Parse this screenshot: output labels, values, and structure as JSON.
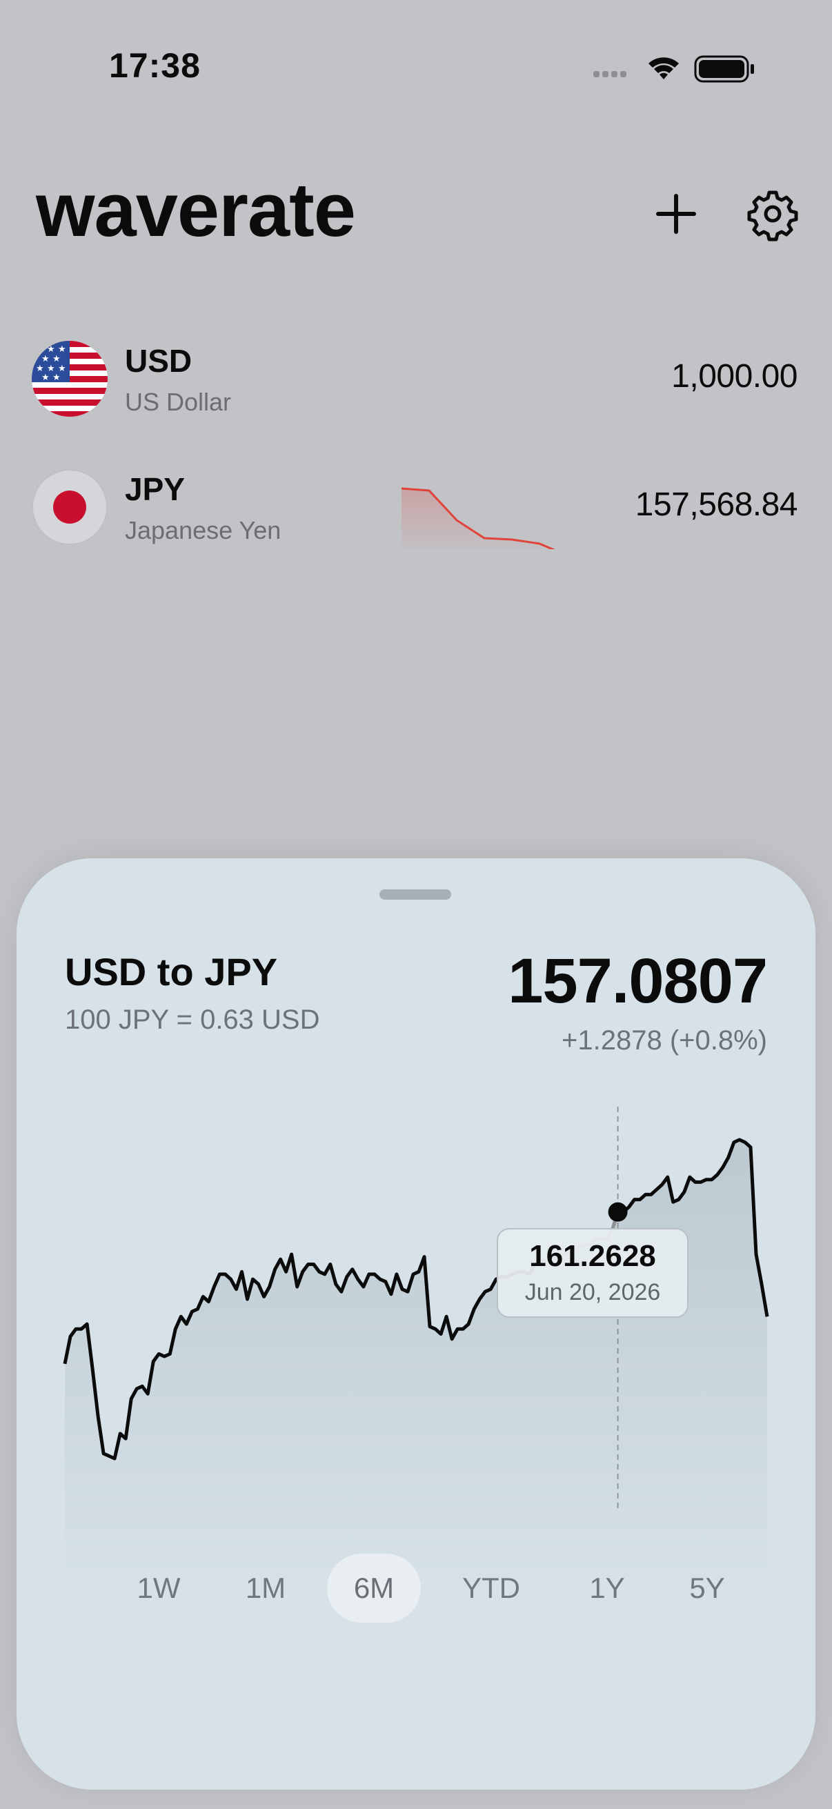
{
  "status": {
    "time": "17:38"
  },
  "app": {
    "title": "waverate"
  },
  "header": {
    "add_icon": "plus-icon",
    "settings_icon": "gear-icon"
  },
  "currencies": [
    {
      "code": "USD",
      "name": "US Dollar",
      "amount": "1,000.00",
      "flag": "us-flag-icon"
    },
    {
      "code": "JPY",
      "name": "Japanese Yen",
      "amount": "157,568.84",
      "flag": "jp-flag-icon",
      "trend": "down",
      "trend_color": "#e0433a"
    }
  ],
  "detail": {
    "pair_title": "USD to JPY",
    "pair_sub": "100 JPY = 0.63 USD",
    "rate": "157.0807",
    "change": "+1.2878 (+0.8%)",
    "tooltip": {
      "value": "161.2628",
      "date": "Jun 20, 2026"
    },
    "ranges": [
      "1W",
      "1M",
      "6M",
      "YTD",
      "1Y",
      "5Y"
    ],
    "active_range": "6M"
  },
  "chart_data": {
    "type": "area",
    "series": [
      {
        "values": [
          155.2,
          156.3,
          156.6,
          156.6,
          156.8,
          155.0,
          153.1,
          151.6,
          151.5,
          151.4,
          152.4,
          152.2,
          153.8,
          154.2,
          154.3,
          154.0,
          155.3,
          155.6,
          155.5,
          155.6,
          156.6,
          157.1,
          156.8,
          157.3,
          157.4,
          157.9,
          157.7,
          158.3,
          158.8,
          158.8,
          158.6,
          158.2,
          158.9,
          157.8,
          158.6,
          158.4,
          157.9,
          158.3,
          159.0,
          159.4,
          158.9,
          159.6,
          158.3,
          158.9,
          159.2,
          159.2,
          158.9,
          158.8,
          159.2,
          158.4,
          158.1,
          158.7,
          159.0,
          158.6,
          158.3,
          158.8,
          158.8,
          158.6,
          158.5,
          158.0,
          158.8,
          158.2,
          158.1,
          158.8,
          158.9,
          159.5,
          156.7,
          156.6,
          156.4,
          157.1,
          156.2,
          156.6,
          156.6,
          156.8,
          157.4,
          157.8,
          158.1,
          158.2,
          158.6,
          158.7,
          158.7,
          158.8,
          158.9,
          158.9,
          158.8,
          159.2,
          159.3,
          159.4,
          159.5,
          159.4,
          159.6,
          159.6,
          159.7,
          159.9,
          160.0,
          160.0,
          160.2,
          160.2,
          160.2,
          160.6,
          161.3,
          161.3,
          161.5,
          161.8,
          161.8,
          162.0,
          162.0,
          162.2,
          162.4,
          162.7,
          161.7,
          161.8,
          162.1,
          162.7,
          162.5,
          162.5,
          162.6,
          162.6,
          162.8,
          163.1,
          163.5,
          164.1,
          164.2,
          164.1,
          163.9,
          159.6,
          158.4,
          157.1
        ]
      }
    ],
    "highlight": {
      "value": 161.2628,
      "date": "Jun 20, 2026"
    },
    "grid": false
  }
}
